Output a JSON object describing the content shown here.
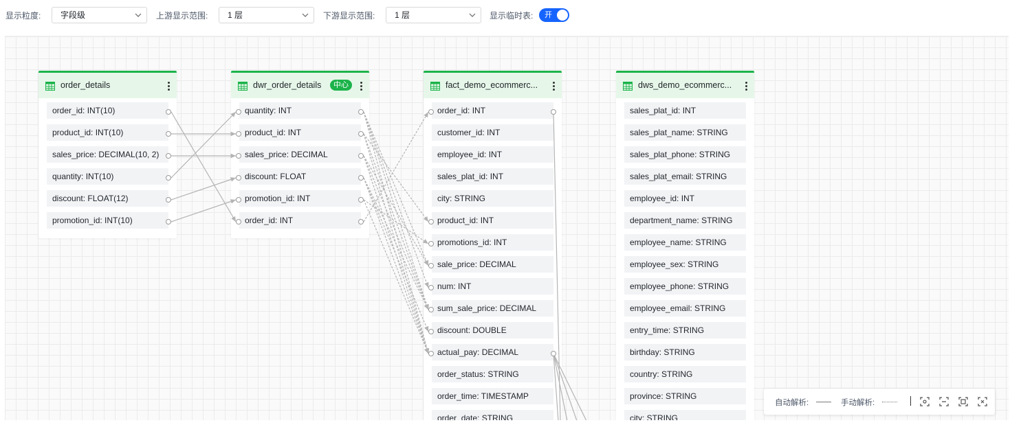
{
  "toolbar": {
    "granularity": {
      "label": "显示粒度:",
      "value": "字段级"
    },
    "upstream": {
      "label": "上游显示范围:",
      "value": "1 层"
    },
    "downstream": {
      "label": "下游显示范围:",
      "value": "1 层"
    },
    "temp_table": {
      "label": "显示临时表:",
      "toggle_text": "开",
      "state": "on"
    }
  },
  "tables": [
    {
      "name": "order_details",
      "badge": null,
      "icon": "table-icon",
      "fields": [
        "order_id: INT(10)",
        "product_id: INT(10)",
        "sales_price: DECIMAL(10, 2)",
        "quantity: INT(10)",
        "discount: FLOAT(12)",
        "promotion_id: INT(10)"
      ]
    },
    {
      "name": "dwr_order_details",
      "badge": "中心",
      "icon": "table-icon",
      "fields": [
        "quantity: INT",
        "product_id: INT",
        "sales_price: DECIMAL",
        "discount: FLOAT",
        "promotion_id: INT",
        "order_id: INT"
      ]
    },
    {
      "name": "fact_demo_ecommerc...",
      "badge": null,
      "icon": "table-icon",
      "fields": [
        "order_id: INT",
        "customer_id: INT",
        "employee_id: INT",
        "sales_plat_id: INT",
        "city: STRING",
        "product_id: INT",
        "promotions_id: INT",
        "sale_price: DECIMAL",
        "num: INT",
        "sum_sale_price: DECIMAL",
        "discount: DOUBLE",
        "actual_pay: DECIMAL",
        "order_status: STRING",
        "order_time: TIMESTAMP",
        "order_date: STRING"
      ]
    },
    {
      "name": "dws_demo_ecommerc...",
      "badge": null,
      "icon": "table-icon",
      "fields": [
        "sales_plat_id: INT",
        "sales_plat_name: STRING",
        "sales_plat_phone: STRING",
        "sales_plat_email: STRING",
        "employee_id: INT",
        "department_name: STRING",
        "employee_name: STRING",
        "employee_sex: STRING",
        "employee_phone: STRING",
        "employee_email: STRING",
        "entry_time: STRING",
        "birthday: STRING",
        "country: STRING",
        "province: STRING",
        "city: STRING"
      ]
    }
  ],
  "legend": {
    "auto_label": "自动解析:",
    "manual_label": "手动解析:",
    "icons": [
      "fit-view-icon",
      "center-icon",
      "zoom-reset-icon",
      "fullscreen-icon"
    ]
  },
  "colors": {
    "accent": "#1664ff",
    "table_header": "#e6f7e9",
    "table_border": "#1cb34a",
    "edge": "#b4b4b4"
  }
}
